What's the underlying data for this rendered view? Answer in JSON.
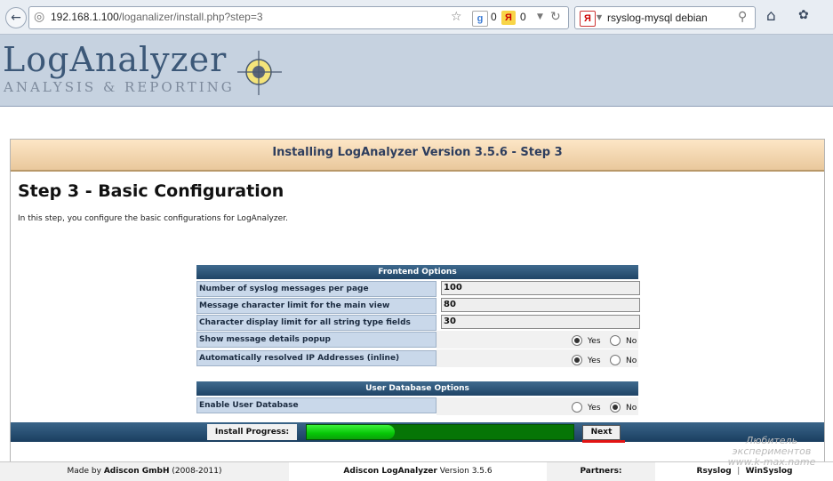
{
  "browser": {
    "url_host": "192.168.1.100",
    "url_path": "/loganalizer/install.php?step=3",
    "badge_g_count": "0",
    "badge_y_count": "0",
    "search_text": "rsyslog-mysql debian"
  },
  "header": {
    "logo_title": "LogAnalyzer",
    "logo_subtitle": "ANALYSIS & REPORTING"
  },
  "install": {
    "step_header": "Installing LogAnalyzer Version 3.5.6 - Step 3",
    "step_title": "Step 3 - Basic Configuration",
    "step_description": "In this step, you configure the basic configurations for LogAnalyzer.",
    "frontend_section": "Frontend Options",
    "fields": [
      {
        "label": "Number of syslog messages per page",
        "value": "100"
      },
      {
        "label": "Message character limit for the main view",
        "value": "80"
      },
      {
        "label": "Character display limit for all string type fields",
        "value": "30"
      }
    ],
    "radios": [
      {
        "label": "Show message details popup",
        "yes": "Yes",
        "no": "No",
        "selected": "yes"
      },
      {
        "label": "Automatically resolved IP Addresses (inline)",
        "yes": "Yes",
        "no": "No",
        "selected": "yes"
      }
    ],
    "userdb_section": "User Database Options",
    "userdb": {
      "label": "Enable User Database",
      "yes": "Yes",
      "no": "No",
      "selected": "no"
    },
    "progress_label": "Install Progress:",
    "progress_fraction": 0.33,
    "next_label": "Next"
  },
  "footer": {
    "made_by_prefix": "Made by",
    "made_by_company": "Adiscon GmbH",
    "made_by_years": "(2008-2011)",
    "product_name": "Adiscon LogAnalyzer",
    "product_version": "Version 3.5.6",
    "partners_label": "Partners:",
    "partner_1": "Rsyslog",
    "partner_2": "WinSyslog"
  },
  "watermark": {
    "line1": "Любитель",
    "line2": "экспериментов",
    "line3": "www.k-max.name"
  },
  "colors": {
    "progress_green": "#06c606",
    "section_blue": "#1f4466",
    "step_header_bg": "#fde6c6",
    "underline_red": "#e21414"
  }
}
